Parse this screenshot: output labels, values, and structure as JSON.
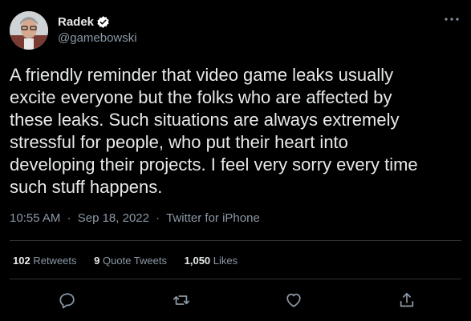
{
  "author": {
    "display_name": "Radek",
    "handle": "@gamebowski",
    "verified_icon": "verified-badge-icon",
    "avatar_icon": "avatar-photo"
  },
  "tweet": {
    "text": "A friendly reminder that video game leaks usually\nexcite everyone but the folks who are affected by\nthese leaks. Such situations are always extremely\nstressful for people, who put their heart into\ndeveloping their projects. I feel very sorry every time\nsuch stuff happens.",
    "time": "10:55 AM",
    "date": "Sep 18, 2022",
    "source": "Twitter for iPhone",
    "separator": "·"
  },
  "stats": {
    "retweets_count": "102",
    "retweets_label": "Retweets",
    "quote_tweets_count": "9",
    "quote_tweets_label": "Quote Tweets",
    "likes_count": "1,050",
    "likes_label": "Likes"
  },
  "actions": {
    "reply": "reply-icon",
    "retweet": "retweet-icon",
    "like": "like-heart-icon",
    "share": "share-icon",
    "more": "more-options-icon"
  },
  "colors": {
    "background": "#000000",
    "text_primary": "#e7e9ea",
    "text_secondary": "#8b98a5",
    "divider": "#2f3336",
    "verified": "#ffffff"
  }
}
